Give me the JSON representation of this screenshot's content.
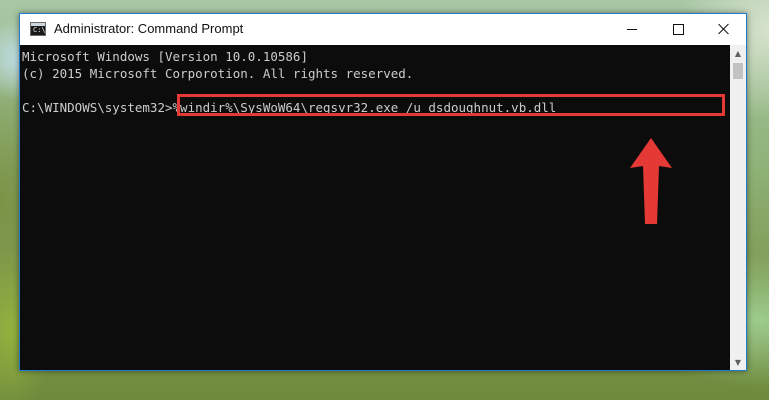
{
  "window": {
    "title": "Administrator: Command Prompt",
    "icon": "cmd-icon",
    "icon_text": "C:\\",
    "controls": {
      "minimize": "minimize-icon",
      "maximize": "maximize-icon",
      "close": "close-icon"
    }
  },
  "console": {
    "line1": "Microsoft Windows [Version 10.0.10586]",
    "line2": "(c) 2015 Microsoft Corporotion. All rights reserved.",
    "prompt": "C:\\WINDOWS\\system32>",
    "command": "%windir%\\SysWoW64\\regsvr32.exe /u dsdoughnut.vb.dll"
  },
  "annotation": {
    "highlight_color": "#e53935",
    "arrow_icon": "up-arrow-icon"
  },
  "scrollbar": {
    "up_icon": "scroll-up-icon",
    "down_icon": "scroll-down-icon",
    "up_glyph": "▲",
    "down_glyph": "▼"
  }
}
